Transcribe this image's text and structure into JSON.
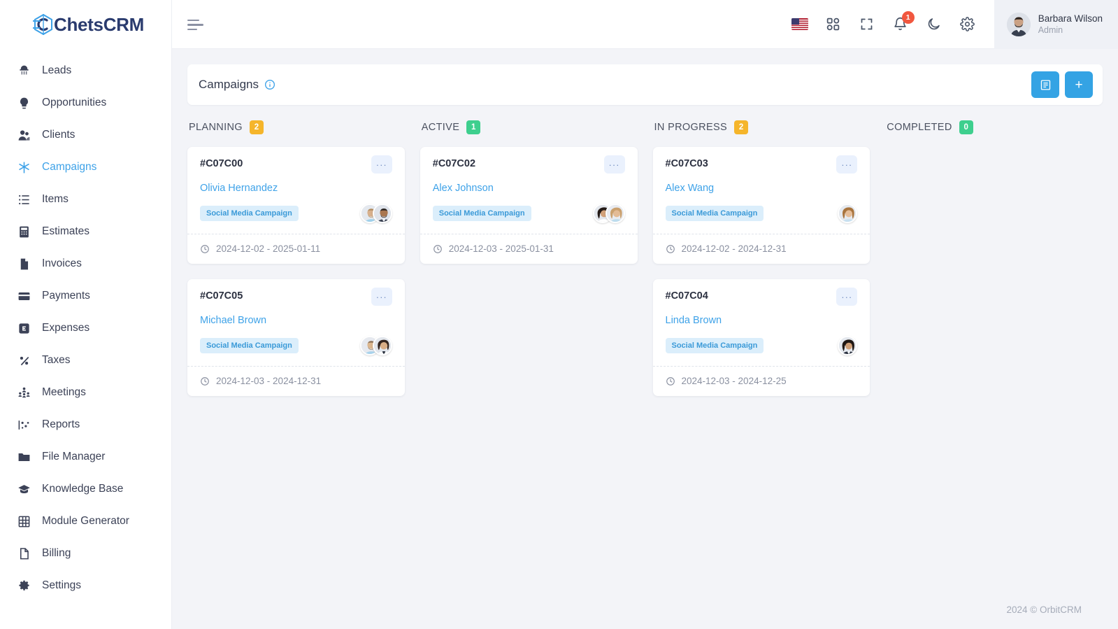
{
  "brand": {
    "name": "ChetsCRM",
    "icon": "chets-logo-icon"
  },
  "sidebar": {
    "items": [
      {
        "label": "Leads",
        "icon": "megaphone-icon",
        "active": false
      },
      {
        "label": "Opportunities",
        "icon": "lightbulb-icon",
        "active": false
      },
      {
        "label": "Clients",
        "icon": "users-icon",
        "active": false
      },
      {
        "label": "Campaigns",
        "icon": "asterisk-icon",
        "active": true
      },
      {
        "label": "Items",
        "icon": "list-icon",
        "active": false
      },
      {
        "label": "Estimates",
        "icon": "calculator-icon",
        "active": false
      },
      {
        "label": "Invoices",
        "icon": "file-icon",
        "active": false
      },
      {
        "label": "Payments",
        "icon": "card-icon",
        "active": false
      },
      {
        "label": "Expenses",
        "icon": "expense-icon",
        "active": false
      },
      {
        "label": "Taxes",
        "icon": "percent-icon",
        "active": false
      },
      {
        "label": "Meetings",
        "icon": "people-group-icon",
        "active": false
      },
      {
        "label": "Reports",
        "icon": "chart-icon",
        "active": false
      },
      {
        "label": "File Manager",
        "icon": "folder-icon",
        "active": false
      },
      {
        "label": "Knowledge Base",
        "icon": "graduation-cap-icon",
        "active": false
      },
      {
        "label": "Module Generator",
        "icon": "grid-table-icon",
        "active": false
      },
      {
        "label": "Billing",
        "icon": "document-icon",
        "active": false
      },
      {
        "label": "Settings",
        "icon": "gear-icon",
        "active": false
      }
    ]
  },
  "topbar": {
    "menu_toggle": "hamburger-menu-icon",
    "icons": [
      {
        "name": "language-flag-us-icon"
      },
      {
        "name": "apps-grid-icon"
      },
      {
        "name": "fullscreen-icon"
      },
      {
        "name": "notifications-bell-icon",
        "badge": "1"
      },
      {
        "name": "dark-mode-moon-icon"
      },
      {
        "name": "settings-gear-icon"
      }
    ],
    "profile": {
      "name": "Barbara Wilson",
      "role": "Admin"
    }
  },
  "page": {
    "title": "Campaigns",
    "info_icon": "info-circle-icon",
    "actions": [
      {
        "name": "list-view-button",
        "glyph": "▤"
      },
      {
        "name": "add-campaign-button",
        "glyph": "+"
      }
    ]
  },
  "colors": {
    "accent": "#34a3e4",
    "badge_amber": "#f5b52b",
    "badge_green": "#3ecf8e",
    "tag_bg": "#dbeefb",
    "tag_text": "#3b9ad8"
  },
  "board": {
    "columns": [
      {
        "name": "PLANNING",
        "count": "2",
        "count_color": "#f5b52b",
        "cards": [
          {
            "id": "#C07C00",
            "person": "Olivia Hernandez",
            "tag": "Social Media Campaign",
            "dates": "2024-12-02 - 2025-01-11",
            "menu": "···",
            "avatars": [
              "#c9b8a6",
              "#7d6450"
            ]
          },
          {
            "id": "#C07C05",
            "person": "Michael Brown",
            "tag": "Social Media Campaign",
            "dates": "2024-12-03 - 2024-12-31",
            "menu": "···",
            "avatars": [
              "#d3bda8",
              "#4b3b33"
            ]
          }
        ]
      },
      {
        "name": "ACTIVE",
        "count": "1",
        "count_color": "#3ecf8e",
        "cards": [
          {
            "id": "#C07C02",
            "person": "Alex Johnson",
            "tag": "Social Media Campaign",
            "dates": "2024-12-03 - 2025-01-31",
            "menu": "···",
            "avatars": [
              "#3a2b26",
              "#c7a98c"
            ]
          }
        ]
      },
      {
        "name": "IN PROGRESS",
        "count": "2",
        "count_color": "#f5b52b",
        "cards": [
          {
            "id": "#C07C03",
            "person": "Alex Wang",
            "tag": "Social Media Campaign",
            "dates": "2024-12-02 - 2024-12-31",
            "menu": "···",
            "avatars": [
              "#b98f6a"
            ]
          },
          {
            "id": "#C07C04",
            "person": "Linda Brown",
            "tag": "Social Media Campaign",
            "dates": "2024-12-03 - 2024-12-25",
            "menu": "···",
            "avatars": [
              "#4a342b"
            ]
          }
        ]
      },
      {
        "name": "COMPLETED",
        "count": "0",
        "count_color": "#3ecf8e",
        "cards": []
      }
    ]
  },
  "footer": {
    "text": "2024 © OrbitCRM"
  }
}
